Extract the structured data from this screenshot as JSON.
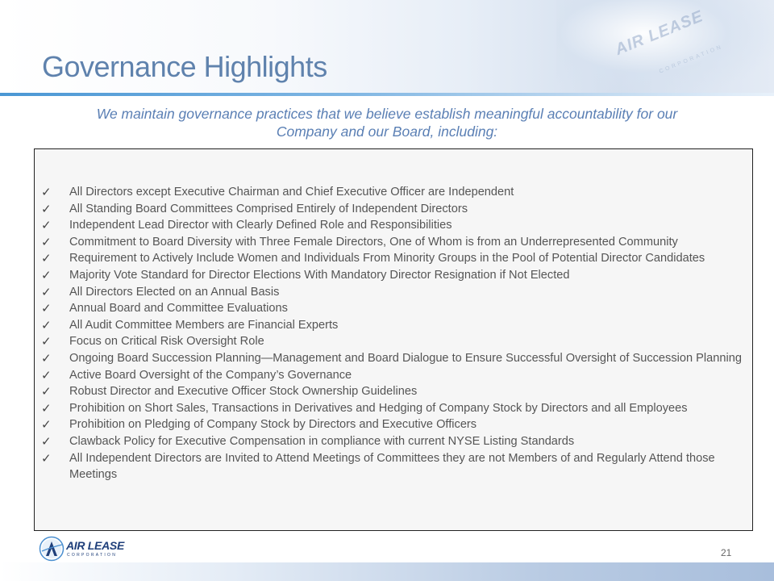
{
  "header": {
    "title": "Governance Highlights",
    "background_logo_text": "AIR LEASE",
    "background_logo_subtext": "CORPORATION"
  },
  "subtitle": {
    "line1": "We maintain governance practices that we believe establish meaningful accountability for our",
    "line2": "Company and our Board, including:"
  },
  "highlights": [
    {
      "text": "All Directors except Executive Chairman and Chief Executive Officer are Independent"
    },
    {
      "text": "All Standing Board Committees Comprised Entirely of Independent Directors"
    },
    {
      "text": "Independent Lead Director with Clearly Defined Role and Responsibilities"
    },
    {
      "text": "Commitment to Board Diversity with Three Female Directors, One of Whom is from an Underrepresented Community"
    },
    {
      "text": "Requirement to Actively Include Women and Individuals From Minority Groups in the Pool of Potential Director Candidates"
    },
    {
      "text": "Majority Vote Standard for Director Elections With Mandatory Director Resignation if Not Elected"
    },
    {
      "text": "All Directors Elected on an Annual Basis"
    },
    {
      "text": "Annual Board and Committee Evaluations"
    },
    {
      "text": "All Audit Committee Members are Financial Experts"
    },
    {
      "text": "Focus on Critical Risk Oversight Role"
    },
    {
      "text": "Ongoing Board Succession Planning—Management and Board Dialogue to Ensure Successful Oversight of Succession Planning"
    },
    {
      "text": "Active Board Oversight of the Company’s Governance"
    },
    {
      "text": "Robust Director and Executive Officer Stock Ownership Guidelines"
    },
    {
      "text": "Prohibition on Short Sales, Transactions in Derivatives and Hedging of Company Stock by Directors and all Employees"
    },
    {
      "text": "Prohibition on Pledging of Company Stock by Directors and Executive Officers"
    },
    {
      "text": "Clawback Policy for Executive Compensation in compliance with current NYSE Listing Standards"
    },
    {
      "text": "All Independent Directors are Invited to Attend Meetings of Committees they are not Members of and Regularly Attend those Meetings"
    }
  ],
  "check_glyph": "✓",
  "footer": {
    "logo_text": "AIR LEASE",
    "logo_subtext": "CORPORATION",
    "page_number": "21"
  },
  "colors": {
    "title": "#5f82ad",
    "subtitle": "#5a7fb4",
    "rule": "#4a97d4",
    "logo": "#1f3f7a"
  }
}
